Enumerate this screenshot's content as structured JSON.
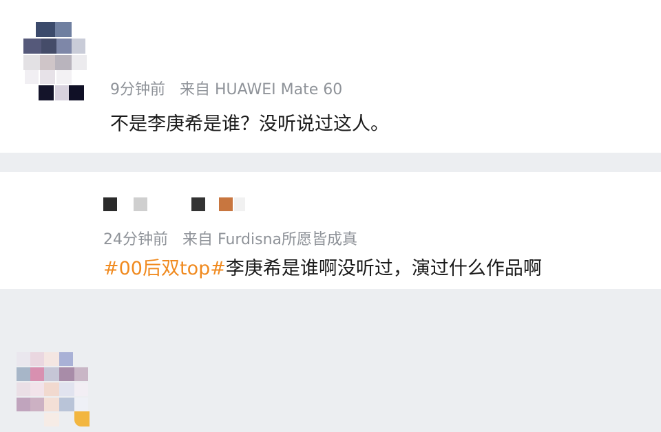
{
  "comments": [
    {
      "time": "9分钟前",
      "source": "来自 HUAWEI Mate 60",
      "text": "不是李庚希是谁？没听说过这人。"
    },
    {
      "time": "24分钟前",
      "source": "来自 Furdisna所愿皆成真",
      "hashtag": "#00后双top#",
      "text": "李庚希是谁啊没听过，演过什么作品啊"
    }
  ],
  "colors": {
    "background": "#eceef1",
    "card": "#ffffff",
    "meta_text": "#8f9399",
    "body_text": "#1a1a1a",
    "hashtag": "#f08a1f",
    "badge": "#f2b640"
  }
}
